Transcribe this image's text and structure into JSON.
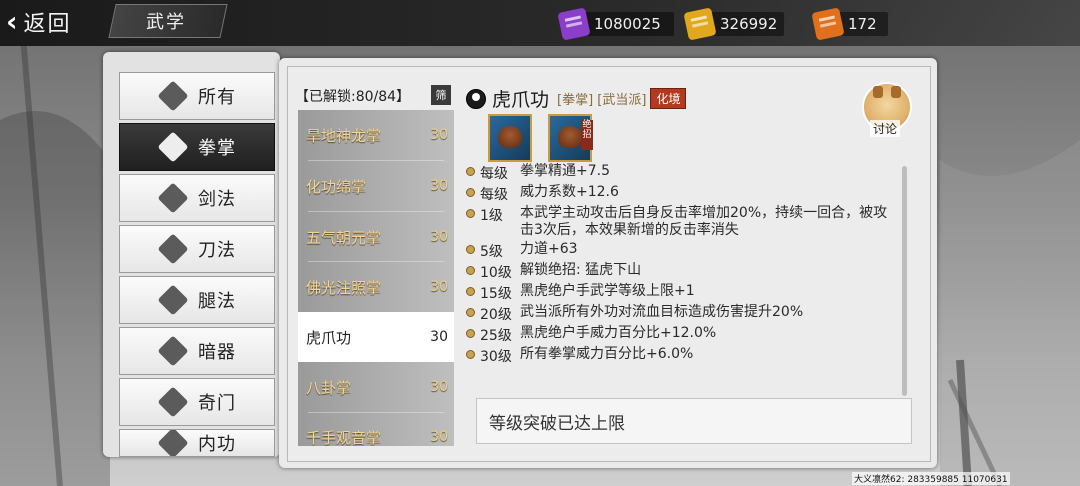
{
  "top": {
    "back_label": "返回",
    "title": "武学",
    "resources": [
      {
        "name": "purple-scroll-icon",
        "value": "1080025",
        "color": "#8b3ec9"
      },
      {
        "name": "gold-scroll-icon",
        "value": "326992",
        "color": "#e0a81c"
      },
      {
        "name": "fire-scroll-icon",
        "value": "172",
        "color": "#e0701c"
      }
    ]
  },
  "categories": [
    {
      "label": "所有",
      "icon": "all-icon"
    },
    {
      "label": "拳掌",
      "icon": "fist-icon",
      "active": true
    },
    {
      "label": "剑法",
      "icon": "sword-icon"
    },
    {
      "label": "刀法",
      "icon": "blade-icon"
    },
    {
      "label": "腿法",
      "icon": "kick-icon"
    },
    {
      "label": "暗器",
      "icon": "shuriken-icon"
    },
    {
      "label": "奇门",
      "icon": "special-weapon-icon"
    },
    {
      "label": "内功",
      "icon": "internal-icon"
    }
  ],
  "list": {
    "unlocked_label": "【已解锁:80/84】",
    "filter_label": "筛",
    "skills": [
      {
        "name": "旱地神龙掌",
        "level": "30"
      },
      {
        "name": "化功绵掌",
        "level": "30"
      },
      {
        "name": "五气朝元掌",
        "level": "30"
      },
      {
        "name": "佛光注照掌",
        "level": "30"
      },
      {
        "name": "虎爪功",
        "level": "30",
        "selected": true
      },
      {
        "name": "八卦掌",
        "level": "30"
      },
      {
        "name": "千手观音掌",
        "level": "30"
      }
    ]
  },
  "detail": {
    "name": "虎爪功",
    "tags": "[拳掌] [武当派]",
    "realm": "化境",
    "discuss_label": "讨论",
    "moves": [
      {
        "icon": "tiger-claw-move-icon"
      },
      {
        "icon": "tiger-claw-ultimate-icon",
        "badge": "绝招"
      }
    ],
    "effects": [
      {
        "level": "每级",
        "text": "拳掌精通+7.5"
      },
      {
        "level": "每级",
        "text": "威力系数+12.6"
      },
      {
        "level": "1级",
        "text": "本武学主动攻击后自身反击率增加20%，持续一回合，被攻击3次后，本效果新增的反击率消失"
      },
      {
        "level": "5级",
        "text": "力道+63"
      },
      {
        "level": "10级",
        "text": "解锁绝招:  猛虎下山"
      },
      {
        "level": "15级",
        "text": "黑虎绝户手武学等级上限+1"
      },
      {
        "level": "20级",
        "text": "武当派所有外功对流血目标造成伤害提升20%"
      },
      {
        "level": "25级",
        "text": "黑虎绝户手威力百分比+12.0%"
      },
      {
        "level": "30级",
        "text": "所有拳掌威力百分比+6.0%"
      }
    ],
    "break_status": "等级突破已达上限"
  },
  "footer_id": "大义凛然62: 283359885 11070631"
}
